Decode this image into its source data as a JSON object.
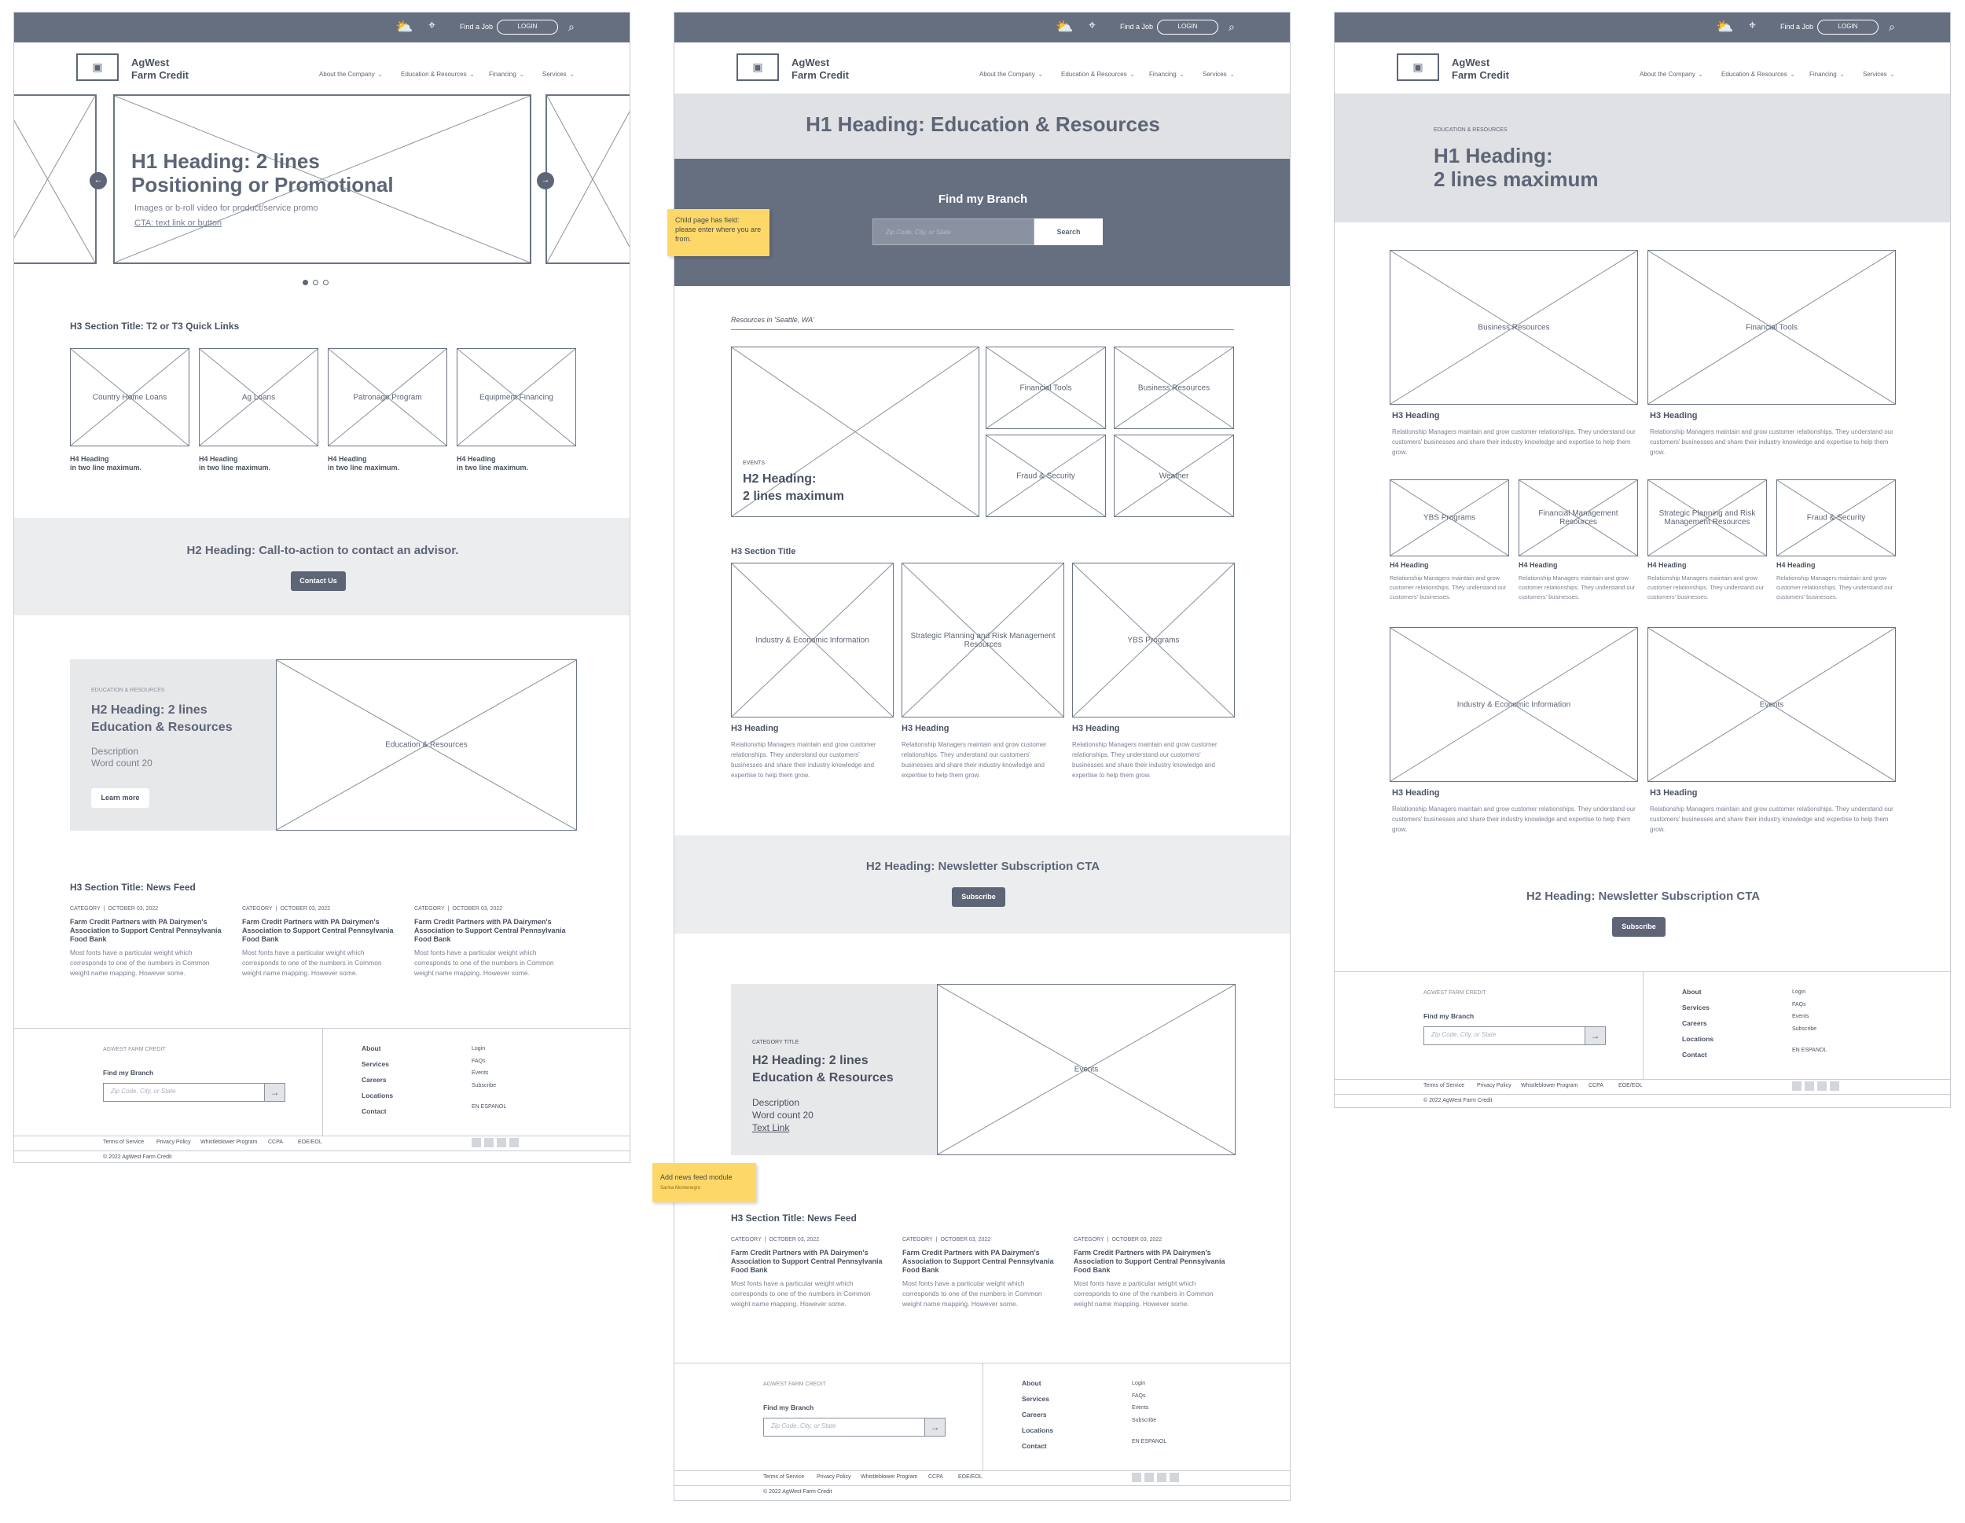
{
  "header": {
    "find_job": "Find a Job",
    "login": "LOGIN",
    "logo_line1": "AgWest",
    "logo_line2": "Farm Credit",
    "nav": [
      "About the Company",
      "Education & Resources",
      "Financing",
      "Services"
    ],
    "icons": [
      "weather-icon",
      "location-pin-icon",
      "search-icon",
      "logo-image-icon",
      "chevron-down-icon"
    ]
  },
  "page1": {
    "hero_h1_line1": "H1 Heading: 2 lines",
    "hero_h1_line2": "Positioning or Promotional",
    "hero_desc": "Images or b-roll video for product/service promo",
    "hero_cta": "CTA: text link or button",
    "quick_title": "H3 Section Title: T2 or T3 Quick Links",
    "quick_links": [
      {
        "label": "Country Home Loans",
        "h4a": "H4 Heading",
        "h4b": "in two line maximum."
      },
      {
        "label": "Ag Loans",
        "h4a": "H4 Heading",
        "h4b": "in two line maximum."
      },
      {
        "label": "Patronage Program",
        "h4a": "H4 Heading",
        "h4b": "in two line maximum."
      },
      {
        "label": "Equipment Financing",
        "h4a": "H4 Heading",
        "h4b": "in two line maximum."
      }
    ],
    "cta_h2": "H2 Heading: Call-to-action to contact an advisor.",
    "cta_btn": "Contact Us",
    "feature_cat": "EDUCATION & RESOURCES",
    "feature_h2a": "H2 Heading: 2 lines",
    "feature_h2b": "Education & Resources",
    "feature_desc1": "Description",
    "feature_desc2": "Word count 20",
    "feature_btn": "Learn more",
    "feature_img": "Education & Resources",
    "news_title": "H3 Section Title: News Feed"
  },
  "news": {
    "category": "CATEGORY",
    "date": "OCTOBER 03, 2022",
    "title": "Farm Credit Partners with PA Dairymen's Association to Support Central Pennsylvania Food Bank",
    "body": "Most fonts have a particular weight which corresponds to one of the numbers in Common weight name mapping. However some."
  },
  "page2": {
    "h1": "H1 Heading: Education & Resources",
    "find_branch": "Find my Branch",
    "zip_placeholder": "Zip Code, City, or State",
    "search_btn": "Search",
    "sticky1": "Child page has field: please enter where you are from.",
    "resources_in": "Resources in 'Seattle, WA'",
    "events_cat": "EVENTS",
    "events_h2a": "H2 Heading:",
    "events_h2b": "2 lines maximum",
    "tiles": [
      "Financial Tools",
      "Business Resources",
      "Fraud & Security",
      "Weather"
    ],
    "section_title": "H3 Section Title",
    "cards": [
      {
        "label": "Industry & Economic Information",
        "h3": "H3 Heading"
      },
      {
        "label": "Strategic Planning and Risk Management Resources",
        "h3": "H3 Heading"
      },
      {
        "label": "YBS Programs",
        "h3": "H3 Heading"
      }
    ],
    "card_body": "Relationship Managers maintain and grow customer relationships. They understand our customers' businesses and share their industry knowledge and expertise to help them grow.",
    "newsletter_h2": "H2 Heading: Newsletter Subscription CTA",
    "subscribe": "Subscribe",
    "feature_cat": "CATEGORY TITLE",
    "feature_h2a": "H2 Heading: 2 lines",
    "feature_h2b": "Education & Resources",
    "feature_desc1": "Description",
    "feature_desc2": "Word count 20",
    "feature_link": "Text Link",
    "feature_img": "Events",
    "sticky2": "Add news feed module",
    "sticky2_author": "Sarina Montenegro",
    "news_title": "H3 Section Title: News Feed"
  },
  "page3": {
    "breadcrumb": "EDUCATION & RESOURCES",
    "h1_line1": "H1 Heading:",
    "h1_line2": "2 lines maximum",
    "big_cards_top": [
      {
        "label": "Business Resources",
        "h3": "H3 Heading"
      },
      {
        "label": "Financial Tools",
        "h3": "H3 Heading"
      }
    ],
    "small_cards": [
      {
        "label": "YBS Programs",
        "h4": "H4 Heading"
      },
      {
        "label": "Financial Management Resources",
        "h4": "H4 Heading"
      },
      {
        "label": "Strategic Planning and Risk Management Resources",
        "h4": "H4 Heading"
      },
      {
        "label": "Fraud & Security",
        "h4": "H4 Heading"
      }
    ],
    "small_body": "Relationship Managers maintain and grow customer relationships. They understand our customers' businesses.",
    "big_cards_bottom": [
      {
        "label": "Industry & Economic Information",
        "h3": "H3 Heading"
      },
      {
        "label": "Events",
        "h3": "H3 Heading"
      }
    ],
    "big_body": "Relationship Managers maintain and grow customer relationships. They understand our customers' businesses and share their industry knowledge and expertise to help them grow.",
    "newsletter_h2": "H2 Heading: Newsletter Subscription CTA",
    "subscribe": "Subscribe"
  },
  "footer": {
    "brand": "AGWEST FARM CREDIT",
    "find_branch": "Find my Branch",
    "zip_placeholder": "Zip Code, City, or State",
    "main_links": [
      "About",
      "Services",
      "Careers",
      "Locations",
      "Contact"
    ],
    "small_links": [
      "Login",
      "FAQs",
      "Events",
      "Subscribe"
    ],
    "lang": "EN ESPANOL",
    "legal": [
      "Terms of Service",
      "Privacy Policy",
      "Whistleblower Program",
      "CCPA",
      "EOE/EOL"
    ],
    "copyright": "© 2022 AgWest Farm Credit"
  }
}
